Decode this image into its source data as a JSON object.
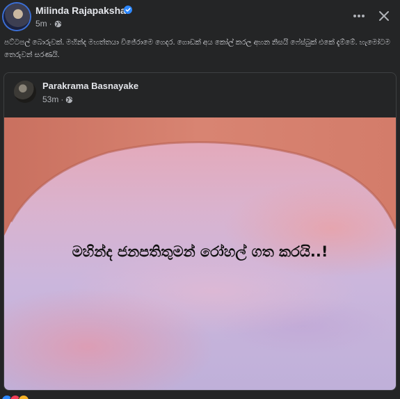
{
  "post": {
    "author": "Milinda Rajapaksha",
    "time": "5m",
    "caption": "පට්ටපල් බොරුවක්. මහින්ද මහත්තයා විජේරාමෙ ගෙදර. ගොඩක් අය කෝල් කරල අහන නිසයි ෆේස්බුක් එකේ දැම්මේ. හැමෝටම තෙරුවන් සරණයි."
  },
  "shared": {
    "author": "Parakrama Basnayake",
    "time": "53m",
    "image_text": "මහින්ද ජනපතිතුමන් රෝහල් ගත කරයි..!"
  },
  "icons": {
    "verified": "verified-badge-icon",
    "privacy": "globe-icon",
    "more": "more-options-icon",
    "close": "close-icon"
  },
  "colors": {
    "background": "#242526",
    "text_primary": "#e4e6eb",
    "text_secondary": "#b0b3b8",
    "verified_blue": "#2d88ff",
    "arch": "#d07a68"
  },
  "reactions": [
    "like",
    "love",
    "haha"
  ]
}
